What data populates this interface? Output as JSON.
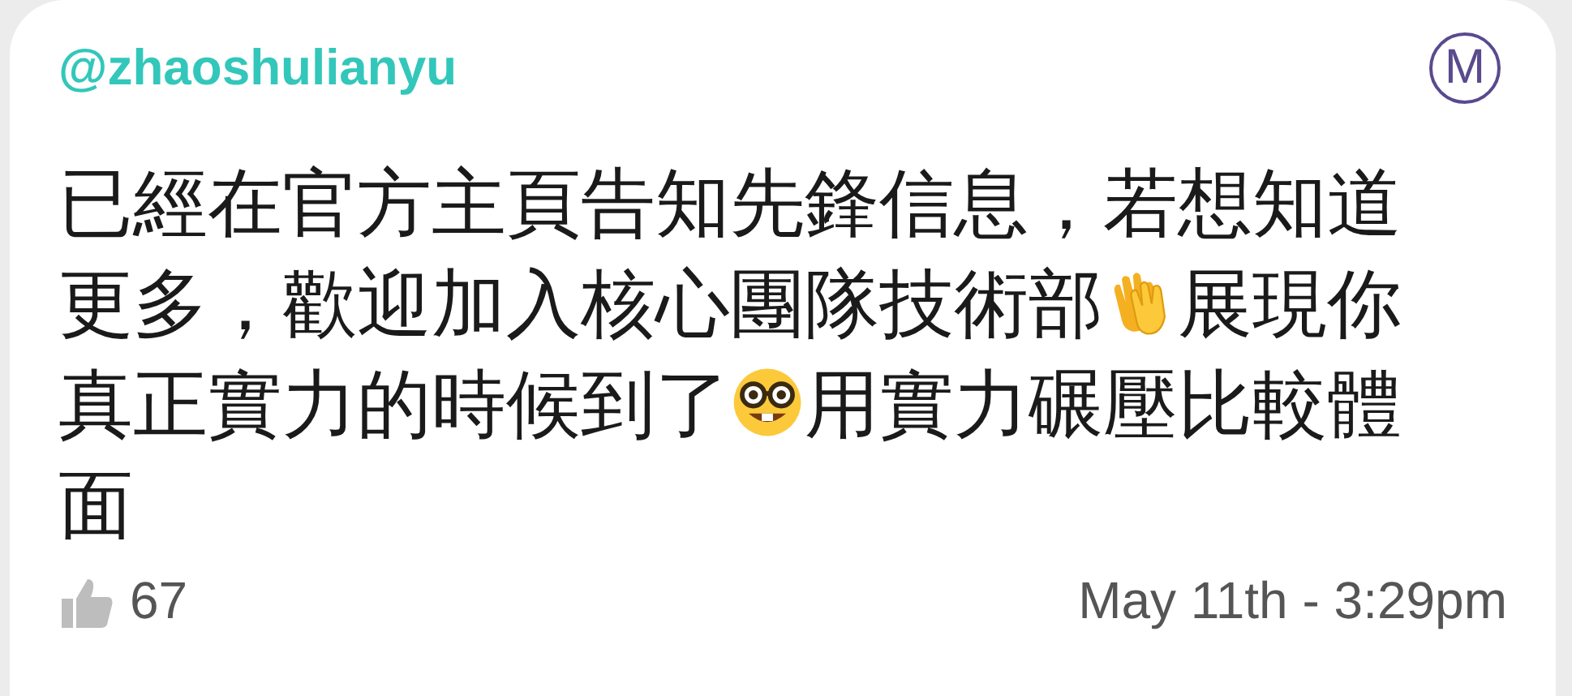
{
  "post": {
    "username": "@zhaoshulianyu",
    "badge": "M",
    "body": [
      {
        "kind": "text",
        "text": "已經在官方主頁告知先鋒信息，若想知道"
      },
      {
        "kind": "text",
        "text": "更多，歡迎加入核心團隊技術部"
      },
      {
        "kind": "clap"
      },
      {
        "kind": "text",
        "text": "展現你"
      },
      {
        "kind": "text",
        "text": "真正實力的時候到了"
      },
      {
        "kind": "nerd"
      },
      {
        "kind": "text",
        "text": "用實力碾壓比較體"
      },
      {
        "kind": "text",
        "text": "面"
      }
    ],
    "likes": "67",
    "timestamp": "May 11th - 3:29pm"
  }
}
